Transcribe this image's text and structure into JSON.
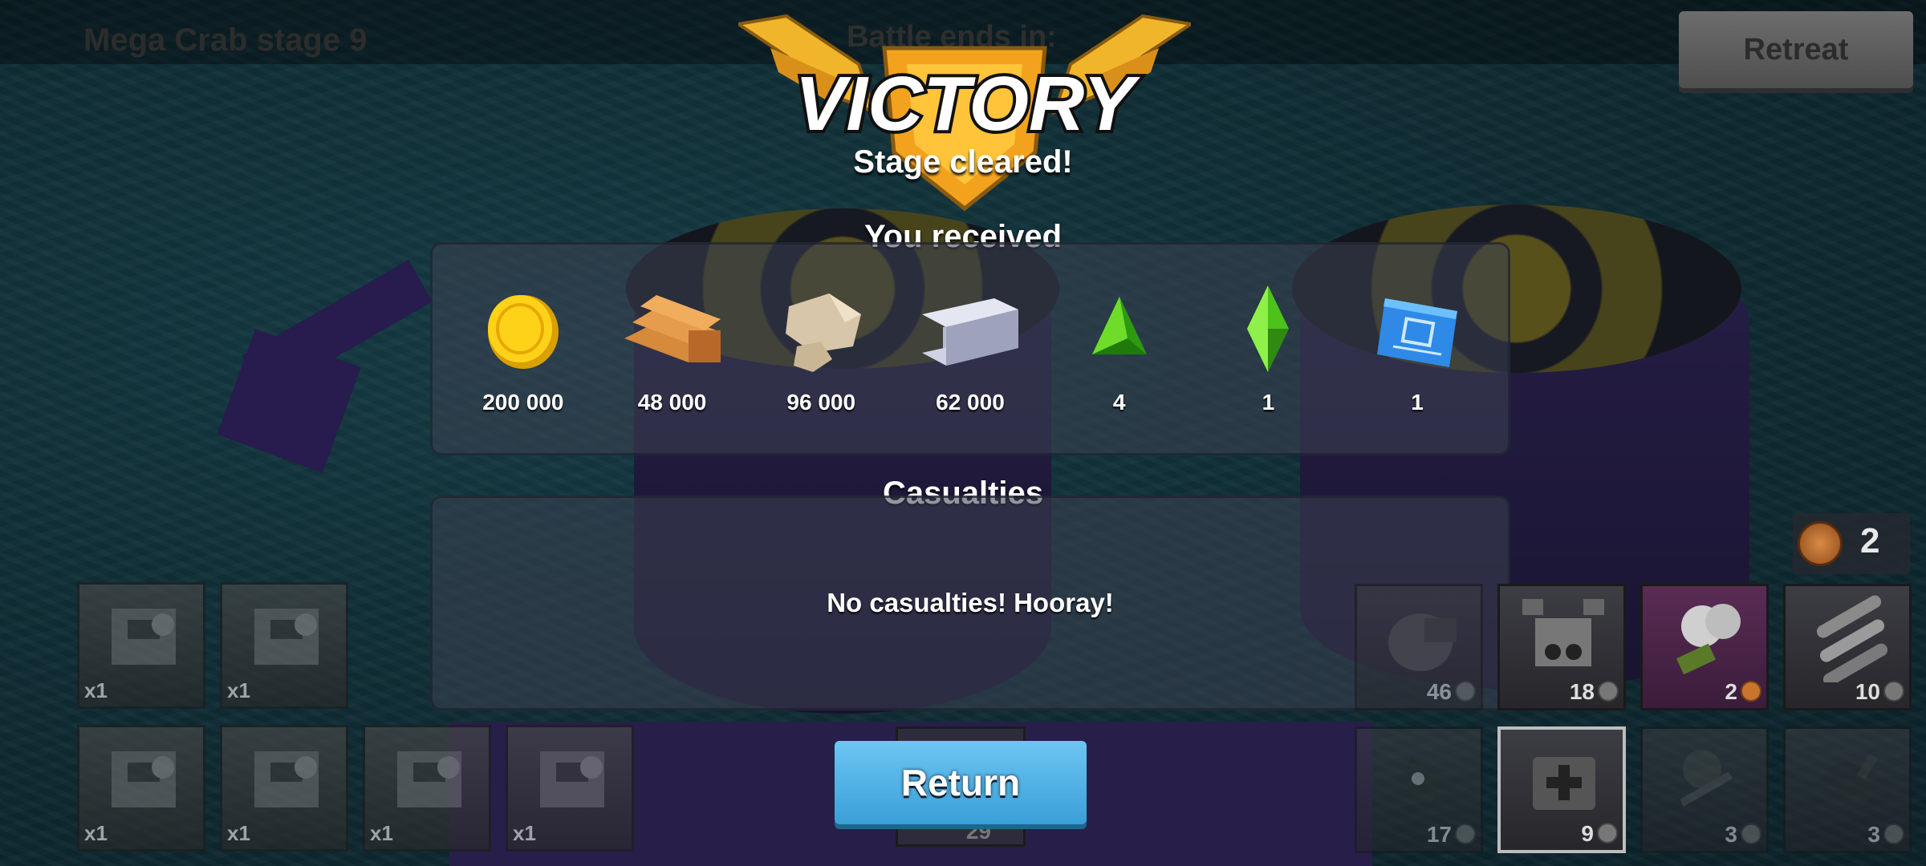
{
  "header": {
    "stage_title": "Mega Crab stage 9",
    "battle_ends_label": "Battle ends in:",
    "retreat_label": "Retreat"
  },
  "result": {
    "title": "VICTORY",
    "subtitle": "Stage cleared!"
  },
  "rewards": {
    "title": "You received",
    "items": [
      {
        "icon": "gold-coin-icon",
        "value": "200 000"
      },
      {
        "icon": "wood-planks-icon",
        "value": "48 000"
      },
      {
        "icon": "stone-icon",
        "value": "96 000"
      },
      {
        "icon": "iron-beam-icon",
        "value": "62 000"
      },
      {
        "icon": "green-triangle-crystal-icon",
        "value": "4"
      },
      {
        "icon": "green-diamond-crystal-icon",
        "value": "1"
      },
      {
        "icon": "blueprint-icon",
        "value": "1"
      }
    ]
  },
  "casualties": {
    "title": "Casualties",
    "message": "No casualties! Hooray!"
  },
  "return_label": "Return",
  "units": [
    {
      "count": "x1"
    },
    {
      "count": "x1"
    },
    {
      "count": "x1"
    },
    {
      "count": "x1"
    },
    {
      "count": "x1"
    },
    {
      "count": "x1"
    }
  ],
  "medals": {
    "count": "2"
  },
  "middle_card": {
    "count": "29"
  },
  "abilities": [
    {
      "icon": "mortar-icon",
      "count": "46"
    },
    {
      "icon": "robot-squad-icon",
      "count": "18"
    },
    {
      "icon": "smoke-tank-icon",
      "count": "2"
    },
    {
      "icon": "missiles-icon",
      "count": "10"
    },
    {
      "icon": "flare-icon",
      "count": "17"
    },
    {
      "icon": "medkit-icon",
      "count": "9"
    },
    {
      "icon": "artillery-icon",
      "count": "3"
    },
    {
      "icon": "bomb-icon",
      "count": "3"
    }
  ],
  "colors": {
    "victory_gold": "#f0b52a",
    "return_blue": "#4aaee3",
    "panel": "#3c4252"
  }
}
